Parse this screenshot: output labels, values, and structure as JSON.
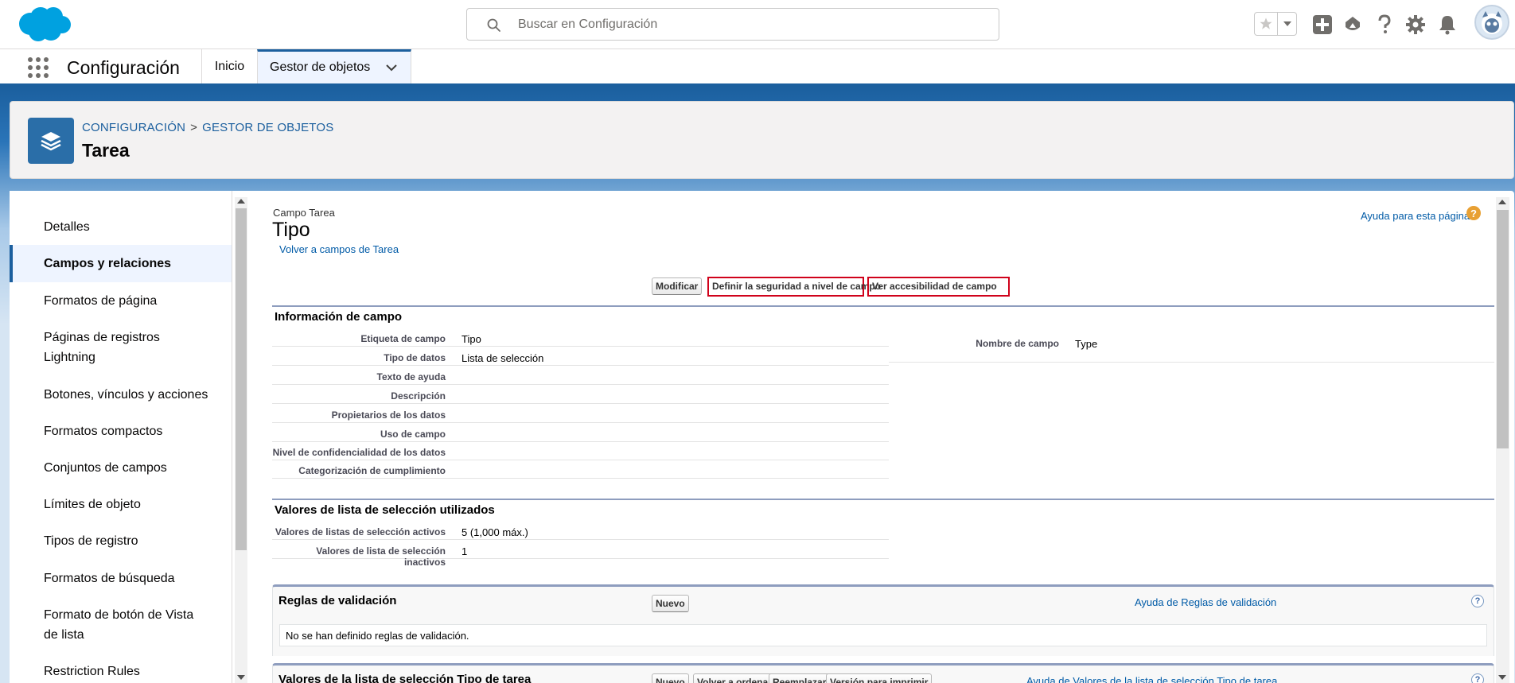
{
  "header": {
    "search_placeholder": "Buscar en Configuración",
    "icons": [
      "salesforce-cloud-logo",
      "search-icon",
      "favorites-star-icon",
      "favorites-dropdown-icon",
      "global-actions-add-icon",
      "trailhead-icon",
      "help-icon",
      "setup-gear-icon",
      "notifications-bell-icon",
      "user-avatar"
    ]
  },
  "nav": {
    "app_name": "Configuración",
    "tabs": [
      {
        "label": "Inicio"
      },
      {
        "label": "Gestor de objetos"
      }
    ]
  },
  "object_header": {
    "breadcrumb": [
      "CONFIGURACIÓN",
      "GESTOR DE OBJETOS"
    ],
    "breadcrumb_sep": ">",
    "title": "Tarea"
  },
  "sidebar": {
    "items": [
      {
        "label": "Detalles"
      },
      {
        "label": "Campos y relaciones",
        "active": true
      },
      {
        "label": "Formatos de página"
      },
      {
        "label": "Páginas de registros Lightning"
      },
      {
        "label": "Botones, vínculos y acciones"
      },
      {
        "label": "Formatos compactos"
      },
      {
        "label": "Conjuntos de campos"
      },
      {
        "label": "Límites de objeto"
      },
      {
        "label": "Tipos de registro"
      },
      {
        "label": "Formatos de búsqueda"
      },
      {
        "label": "Formato de botón de Vista de lista"
      },
      {
        "label": "Restriction Rules"
      }
    ]
  },
  "content": {
    "subtitle": "Campo Tarea",
    "title": "Tipo",
    "back_link": "Volver a campos de Tarea",
    "help_link": "Ayuda para esta página",
    "buttons": {
      "edit": "Modificar",
      "field_security": "Definir la seguridad a nivel de campo",
      "accessibility": "Ver accesibilidad de campo"
    },
    "field_info": {
      "title": "Información de campo",
      "rows": [
        {
          "label": "Etiqueta de campo",
          "value": "Tipo"
        },
        {
          "label": "Tipo de datos",
          "value": "Lista de selección"
        },
        {
          "label": "Texto de ayuda",
          "value": ""
        },
        {
          "label": "Descripción",
          "value": ""
        },
        {
          "label": "Propietarios de los datos",
          "value": ""
        },
        {
          "label": "Uso de campo",
          "value": ""
        },
        {
          "label": "Nivel de confidencialidad de los datos",
          "value": ""
        },
        {
          "label": "Categorización de cumplimiento",
          "value": ""
        }
      ],
      "right": {
        "label": "Nombre de campo",
        "value": "Type"
      }
    },
    "picklist_usage": {
      "title": "Valores de lista de selección utilizados",
      "rows": [
        {
          "label": "Valores de listas de selección activos",
          "value": "5 (1,000 máx.)"
        },
        {
          "label": "Valores de lista de selección inactivos",
          "value": "1"
        }
      ]
    },
    "validation_rules": {
      "title": "Reglas de validación",
      "new_button": "Nuevo",
      "help": "Ayuda de Reglas de validación",
      "empty_message": "No se han definido reglas de validación."
    },
    "picklist_values": {
      "title": "Valores de la lista de selección Tipo de tarea",
      "buttons": [
        "Nuevo",
        "Volver a ordenar",
        "Reemplazar",
        "Versión para imprimir"
      ],
      "help": "Ayuda de Valores de la lista de selección Tipo de tarea"
    }
  },
  "colors": {
    "brand_blue": "#1b5f9e",
    "link": "#015ba7",
    "highlight_border": "#d0021b",
    "object_icon": "#2a6ea8"
  }
}
